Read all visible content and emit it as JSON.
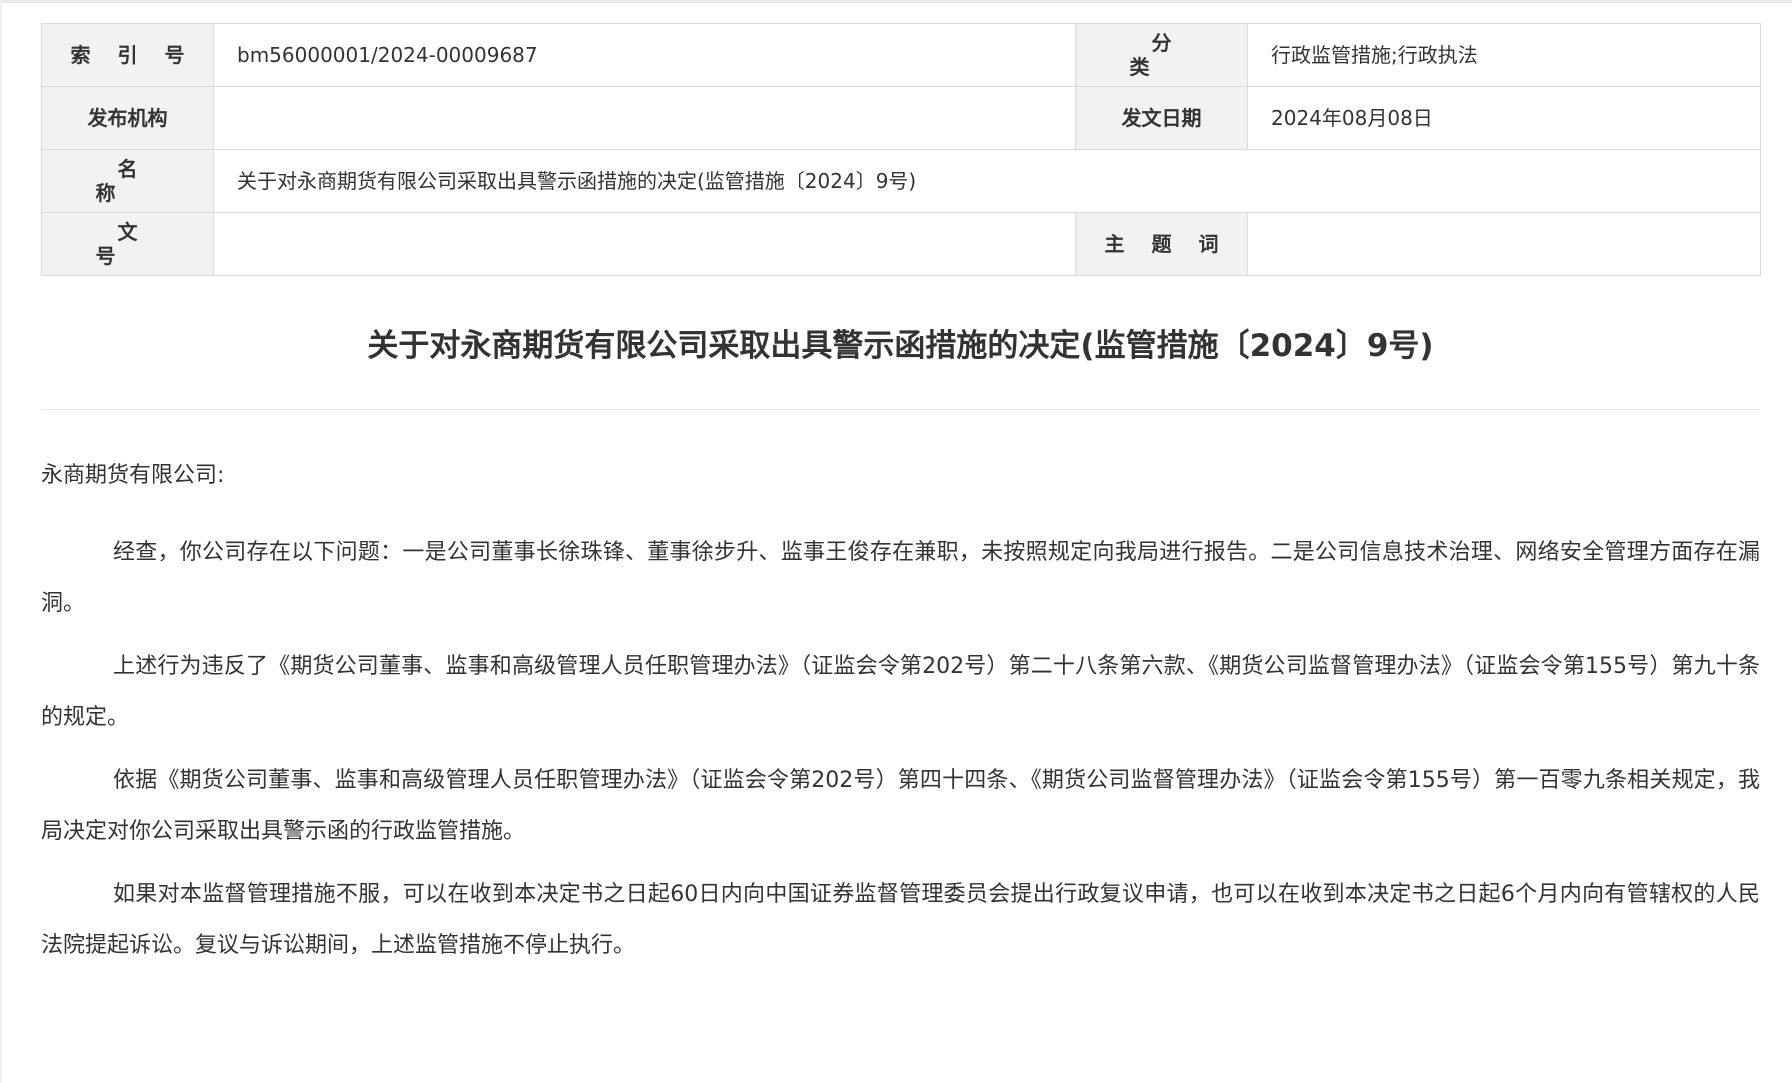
{
  "meta_table": {
    "index_label": "索 引 号",
    "index_value": "bm56000001/2024-00009687",
    "category_label": "分 类",
    "category_value": "行政监管措施;行政执法",
    "issuer_label": "发布机构",
    "issuer_value": "",
    "date_label": "发文日期",
    "date_value": "2024年08月08日",
    "name_label": "名 称",
    "name_value": "关于对永商期货有限公司采取出具警示函措施的决定(监管措施〔2024〕9号)",
    "docno_label": "文 号",
    "docno_value": "",
    "keywords_label": "主 题 词",
    "keywords_value": ""
  },
  "document": {
    "title": "关于对永商期货有限公司采取出具警示函措施的决定(监管措施〔2024〕9号)",
    "salutation": "永商期货有限公司:",
    "paragraphs": [
      "经查，你公司存在以下问题：一是公司董事长徐珠锋、董事徐步升、监事王俊存在兼职，未按照规定向我局进行报告。二是公司信息技术治理、网络安全管理方面存在漏洞。",
      "上述行为违反了《期货公司董事、监事和高级管理人员任职管理办法》（证监会令第202号）第二十八条第六款、《期货公司监督管理办法》（证监会令第155号）第九十条的规定。",
      "依据《期货公司董事、监事和高级管理人员任职管理办法》（证监会令第202号）第四十四条、《期货公司监督管理办法》（证监会令第155号）第一百零九条相关规定，我局决定对你公司采取出具警示函的行政监管措施。",
      "如果对本监督管理措施不服，可以在收到本决定书之日起60日内向中国证券监督管理委员会提出行政复议申请，也可以在收到本决定书之日起6个月内向有管辖权的人民法院提起诉讼。复议与诉讼期间，上述监管措施不停止执行。"
    ]
  }
}
